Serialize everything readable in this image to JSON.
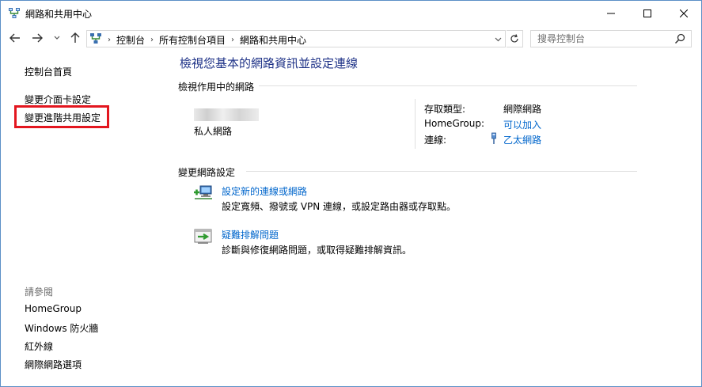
{
  "window": {
    "title": "網路和共用中心"
  },
  "nav": {
    "breadcrumbs": [
      "控制台",
      "所有控制台項目",
      "網路和共用中心"
    ],
    "search_placeholder": "搜尋控制台"
  },
  "sidebar": {
    "home": "控制台首頁",
    "change_adapter": "變更介面卡設定",
    "change_advanced_sharing": "變更進階共用設定",
    "see_also": "請參閱",
    "links": [
      "HomeGroup",
      "Windows 防火牆",
      "紅外線",
      "網際網路選項"
    ]
  },
  "main": {
    "title": "檢視您基本的網路資訊並設定連線",
    "active_networks_header": "檢視作用中的網路",
    "network": {
      "type": "私人網路",
      "access_type_label": "存取類型:",
      "access_type_value": "網際網路",
      "homegroup_label": "HomeGroup:",
      "homegroup_value": "可以加入",
      "connections_label": "連線:",
      "connections_value": "乙太網路"
    },
    "change_settings_header": "變更網路設定",
    "tasks": [
      {
        "link": "設定新的連線或網路",
        "desc": "設定寬頻、撥號或 VPN 連線，或設定路由器或存取點。"
      },
      {
        "link": "疑難排解問題",
        "desc": "診斷與修復網路問題，或取得疑難排解資訊。"
      }
    ]
  },
  "colors": {
    "title_blue": "#1e3287",
    "link_blue": "#0066cc",
    "highlight_red": "#e3161f"
  }
}
